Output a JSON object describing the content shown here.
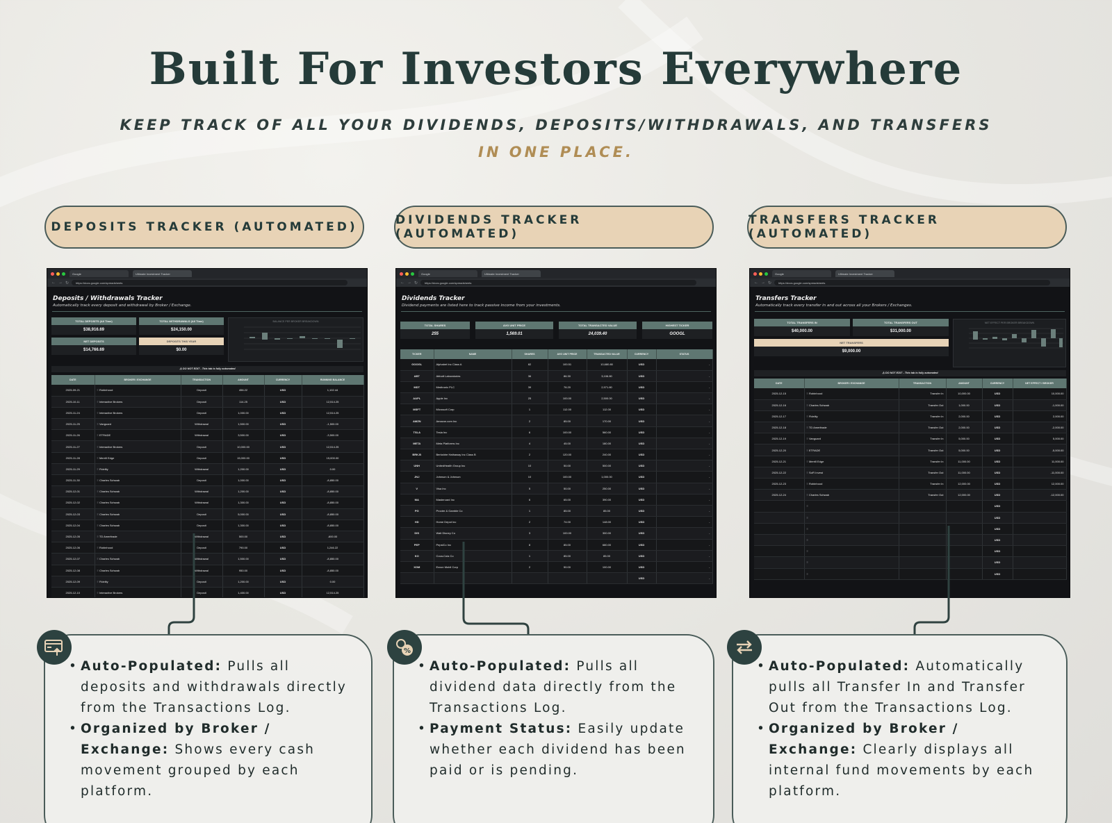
{
  "headline": "Built For Investors Everywhere",
  "subheadline": {
    "line1": "KEEP TRACK OF ALL YOUR DIVIDENDS, DEPOSITS/WITHDRAWALS, AND TRANSFERS",
    "line2": "IN ONE PLACE."
  },
  "colors": {
    "dark_green": "#253b39",
    "sand": "#e8d3b6",
    "gold": "#b08d55",
    "header_green": "#5f7772",
    "sheet_bg": "#121316"
  },
  "browser": {
    "tab1": "Google",
    "tab2": "Ultimate Investment Tracker",
    "url": "https://docs.google.com/spreadsheets"
  },
  "deposits": {
    "pill": "DEPOSITS TRACKER (AUTOMATED)",
    "title": "Deposits / Withdrawals Tracker",
    "subtitle": "Automatically track every deposit and withdrawal by Broker / Exchange.",
    "kpis": {
      "total_deposits_label": "TOTAL DEPOSITS (All Time)",
      "total_deposits_value": "$38,916.69",
      "total_withdrawals_label": "TOTAL WITHDRAWALS (All Time)",
      "total_withdrawals_value": "$24,150.00",
      "net_deposits_label": "NET DEPOSITS",
      "net_deposits_value": "$14,766.69",
      "deposits_year_label": "DEPOSITS THIS YEAR",
      "deposits_year_value": "$0.00"
    },
    "chart_title": "BALANCE PER BROKER BREAKDOWN",
    "warning": "⚠ DO NOT EDIT - This tab is fully automated",
    "columns": [
      "DATE",
      "BROKER / EXCHANGE",
      "TRANSACTION",
      "AMOUNT",
      "CURRENCY",
      "RUNNING BALANCE"
    ],
    "rows": [
      [
        "2025-09-21",
        "Robinhood",
        "Deposit",
        "456.22",
        "USD",
        "1,102.44"
      ],
      [
        "2025-10-11",
        "Interactive Brokers",
        "Deposit",
        "114.25",
        "USD",
        "12,514.25"
      ],
      [
        "2025-11-24",
        "Interactive Brokers",
        "Deposit",
        "1,000.00",
        "USD",
        "12,514.25"
      ],
      [
        "2025-11-25",
        "Vanguard",
        "Withdrawal",
        "1,500.00",
        "USD",
        "-1,500.00"
      ],
      [
        "2025-11-26",
        "ETRADE",
        "Withdrawal",
        "3,500.00",
        "USD",
        "-3,500.00"
      ],
      [
        "2025-11-27",
        "Interactive Brokers",
        "Deposit",
        "10,000.00",
        "USD",
        "12,514.25"
      ],
      [
        "2025-11-28",
        "Merrill Edge",
        "Deposit",
        "15,000.00",
        "USD",
        "15,000.00"
      ],
      [
        "2025-11-29",
        "Fidelity",
        "Withdrawal",
        "1,200.00",
        "USD",
        "0.00"
      ],
      [
        "2025-11-30",
        "Charles Schwab",
        "Deposit",
        "1,000.00",
        "USD",
        "-8,850.00"
      ],
      [
        "2025-12-01",
        "Charles Schwab",
        "Withdrawal",
        "1,200.00",
        "USD",
        "-8,850.00"
      ],
      [
        "2025-12-02",
        "Charles Schwab",
        "Withdrawal",
        "1,300.00",
        "USD",
        "-8,850.00"
      ],
      [
        "2025-12-03",
        "Charles Schwab",
        "Deposit",
        "5,000.00",
        "USD",
        "-8,850.00"
      ],
      [
        "2025-12-04",
        "Charles Schwab",
        "Deposit",
        "1,300.00",
        "USD",
        "-8,850.00"
      ],
      [
        "2025-12-05",
        "TD Ameritrade",
        "Withdrawal",
        "500.00",
        "USD",
        "-600.00"
      ],
      [
        "2025-12-06",
        "Robinhood",
        "Deposit",
        "790.00",
        "USD",
        "1,246.22"
      ],
      [
        "2025-12-07",
        "Charles Schwab",
        "Withdrawal",
        "1,500.00",
        "USD",
        "-8,850.00"
      ],
      [
        "2025-12-08",
        "Charles Schwab",
        "Withdrawal",
        "950.00",
        "USD",
        "-8,850.00"
      ],
      [
        "2025-12-09",
        "Fidelity",
        "Deposit",
        "1,200.00",
        "USD",
        "0.00"
      ],
      [
        "2025-12-10",
        "Interactive Brokers",
        "Deposit",
        "1,400.00",
        "USD",
        "12,514.25"
      ]
    ],
    "bullets": [
      {
        "label": "Auto-Populated:",
        "text": " Pulls all deposits and withdrawals directly from the Transactions Log."
      },
      {
        "label": "Organized by Broker / Exchange:",
        "text": " Shows every cash movement grouped by each platform."
      }
    ],
    "icon": "card-deposit-icon"
  },
  "dividends": {
    "pill": "DIVIDENDS TRACKER (AUTOMATED)",
    "title": "Dividends Tracker",
    "subtitle": "Dividend payments are listed here to track passive income from your investments.",
    "kpis": {
      "total_shares_label": "TOTAL SHARES",
      "total_shares_value": "255",
      "avg_unit_price_label": "AVG UNIT PRICE",
      "avg_unit_price_value": "1,569.01",
      "total_transacted_label": "TOTAL TRANSACTED VALUE",
      "total_transacted_value": "24,039.40",
      "highest_ticker_label": "HIGHEST TICKER",
      "highest_ticker_value": "GOOGL"
    },
    "columns": [
      "TICKER",
      "NAME",
      "SHARES",
      "AVG UNIT PRICE",
      "TRANSACTED VALUE",
      "CURRENCY",
      "STATUS"
    ],
    "rows": [
      [
        "GOOGL",
        "Alphabet Inc Class A",
        "82",
        "100.51",
        "10,680.80",
        "USD",
        "-"
      ],
      [
        "ABT",
        "Abbott Laboratories",
        "36",
        "86.30",
        "3,106.80",
        "USD",
        "-"
      ],
      [
        "MDT",
        "Medtronic PLC",
        "39",
        "76.20",
        "2,971.80",
        "USD",
        "-"
      ],
      [
        "AAPL",
        "Apple Inc",
        "25",
        "100.00",
        "2,500.00",
        "USD",
        "-"
      ],
      [
        "MSFT",
        "Microsoft Corp",
        "1",
        "112.00",
        "112.00",
        "USD",
        "-"
      ],
      [
        "AMZN",
        "Amazon.com Inc",
        "2",
        "85.00",
        "170.00",
        "USD",
        "-"
      ],
      [
        "TSLA",
        "Tesla Inc",
        "6",
        "100.00",
        "560.00",
        "USD",
        "-"
      ],
      [
        "META",
        "Meta Platforms Inc",
        "4",
        "45.00",
        "180.00",
        "USD",
        "-"
      ],
      [
        "BRK.B",
        "Berkshire Hathaway Inc Class B",
        "2",
        "120.00",
        "240.00",
        "USD",
        "-"
      ],
      [
        "UNH",
        "UnitedHealth Group Inc",
        "10",
        "50.00",
        "500.00",
        "USD",
        "-"
      ],
      [
        "JNJ",
        "Johnson & Johnson",
        "10",
        "100.00",
        "1,000.00",
        "USD",
        "-"
      ],
      [
        "V",
        "Visa Inc",
        "5",
        "50.00",
        "250.00",
        "USD",
        "-"
      ],
      [
        "MA",
        "Mastercard Inc",
        "6",
        "65.00",
        "390.00",
        "USD",
        "-"
      ],
      [
        "PG",
        "Procter & Gamble Co",
        "1",
        "85.00",
        "85.00",
        "USD",
        "-"
      ],
      [
        "HD",
        "Home Depot Inc",
        "2",
        "74.00",
        "148.00",
        "USD",
        "-"
      ],
      [
        "DIS",
        "Walt Disney Co",
        "3",
        "100.00",
        "300.00",
        "USD",
        "-"
      ],
      [
        "PEP",
        "PepsiCo Inc",
        "8",
        "85.00",
        "680.00",
        "USD",
        "-"
      ],
      [
        "KO",
        "Coca-Cola Co",
        "1",
        "85.00",
        "85.00",
        "USD",
        "-"
      ],
      [
        "XOM",
        "Exxon Mobil Corp",
        "2",
        "50.00",
        "100.00",
        "USD",
        "-"
      ],
      [
        "",
        "",
        "",
        "",
        "",
        "USD",
        "-"
      ]
    ],
    "bullets": [
      {
        "label": "Auto-Populated:",
        "text": " Pulls all dividend data directly from the Transactions Log."
      },
      {
        "label": "Payment Status:",
        "text": " Easily update whether each dividend has been paid or is pending."
      }
    ],
    "icon": "dividend-percent-icon"
  },
  "transfers": {
    "pill": "TRANSFERS TRACKER (AUTOMATED)",
    "title": "Transfers Tracker",
    "subtitle": "Automatically track every transfer in and out across all your Brokers / Exchanges.",
    "kpis": {
      "transfers_in_label": "TOTAL TRANSFERS IN",
      "transfers_in_value": "$40,000.00",
      "transfers_out_label": "TOTAL TRANSFERS OUT",
      "transfers_out_value": "$31,000.00",
      "net_transfers_label": "NET TRANSFERS",
      "net_transfers_value": "$9,000.00"
    },
    "chart_title": "NET EFFECT PER BROKER BREAKDOWN",
    "warning": "⚠ DO NOT EDIT - This tab is fully automated",
    "columns": [
      "DATE",
      "BROKER / EXCHANGE",
      "TRANSACTION",
      "AMOUNT",
      "CURRENCY",
      "NET EFFECT / BROKER"
    ],
    "rows": [
      [
        "2025-12-15",
        "Robinhood",
        "Transfer In",
        "10,000.00",
        "USD",
        "10,000.00"
      ],
      [
        "2025-12-16",
        "Charles Schwab",
        "Transfer Out",
        "1,000.00",
        "USD",
        "-1,000.00"
      ],
      [
        "2025-12-17",
        "Fidelity",
        "Transfer In",
        "2,000.00",
        "USD",
        "2,000.00"
      ],
      [
        "2025-12-18",
        "TD Ameritrade",
        "Transfer Out",
        "2,000.00",
        "USD",
        "-2,000.00"
      ],
      [
        "2025-12-19",
        "Vanguard",
        "Transfer In",
        "5,000.00",
        "USD",
        "5,000.00"
      ],
      [
        "2025-12-20",
        "ETRADE",
        "Transfer Out",
        "5,000.00",
        "USD",
        "-5,000.00"
      ],
      [
        "2025-12-21",
        "Merrill Edge",
        "Transfer In",
        "11,000.00",
        "USD",
        "11,000.00"
      ],
      [
        "2025-12-22",
        "SoFi Invest",
        "Transfer Out",
        "11,000.00",
        "USD",
        "-11,000.00"
      ],
      [
        "2025-12-23",
        "Robinhood",
        "Transfer In",
        "12,000.00",
        "USD",
        "12,000.00"
      ],
      [
        "2025-12-24",
        "Charles Schwab",
        "Transfer Out",
        "12,000.00",
        "USD",
        "-12,000.00"
      ],
      [
        "",
        "",
        "",
        "",
        "USD",
        ""
      ],
      [
        "",
        "",
        "",
        "",
        "USD",
        ""
      ],
      [
        "",
        "",
        "",
        "",
        "USD",
        ""
      ],
      [
        "",
        "",
        "",
        "",
        "USD",
        ""
      ],
      [
        "",
        "",
        "",
        "",
        "USD",
        ""
      ],
      [
        "",
        "",
        "",
        "",
        "USD",
        ""
      ],
      [
        "",
        "",
        "",
        "",
        "USD",
        ""
      ]
    ],
    "bullets": [
      {
        "label": "Auto-Populated:",
        "text": " Automatically pulls all Transfer In and Transfer Out from the Transactions Log."
      },
      {
        "label": "Organized by Broker / Exchange:",
        "text": " Clearly displays all internal fund movements by each platform."
      }
    ],
    "icon": "swap-arrows-icon"
  }
}
